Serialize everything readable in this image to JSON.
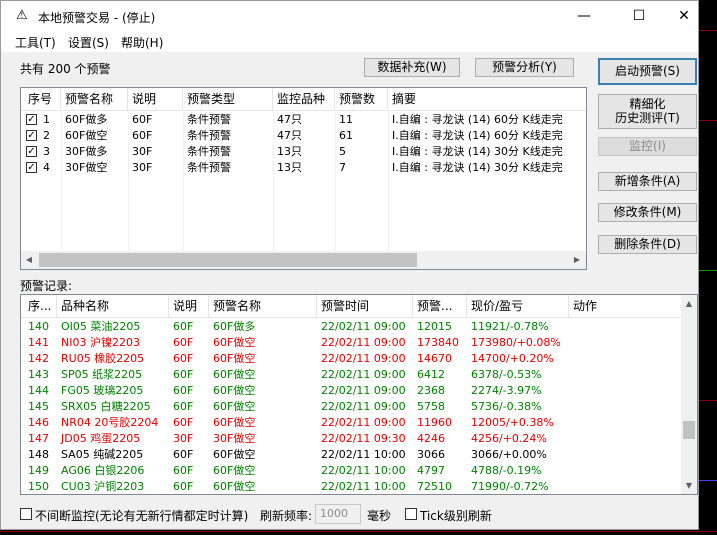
{
  "window": {
    "title": "本地预警交易 - (停止)",
    "app_icon": "warning-triangle-icon",
    "controls": {
      "minimize": "—",
      "maximize": "☐",
      "close": "✕"
    }
  },
  "menu": [
    {
      "label": "工具(T)"
    },
    {
      "label": "设置(S)"
    },
    {
      "label": "帮助(H)"
    }
  ],
  "summary": "共有 200 个预警",
  "toolbar": {
    "data_fill": "数据补充(W)",
    "analysis": "预警分析(Y)"
  },
  "side_buttons": {
    "start": "启动预警(S)",
    "refine_line1": "精细化",
    "refine_line2": "历史测评(T)",
    "monitor": "监控(I)",
    "add": "新增条件(A)",
    "edit": "修改条件(M)",
    "delete": "删除条件(D)"
  },
  "conditions": {
    "headers": [
      "序号",
      "预警名称",
      "说明",
      "预警类型",
      "监控品种",
      "预警数",
      "摘要"
    ],
    "rows": [
      {
        "checked": true,
        "no": "1",
        "name": "60F做多",
        "desc": "60F",
        "type": "条件预警",
        "count_var": "47只",
        "alerts": "11",
        "summary": "I.自编 : 寻龙诀 (14) 60分  K线走完"
      },
      {
        "checked": true,
        "no": "2",
        "name": "60F做空",
        "desc": "60F",
        "type": "条件预警",
        "count_var": "47只",
        "alerts": "61",
        "summary": "I.自编 : 寻龙诀 (14) 60分  K线走完"
      },
      {
        "checked": true,
        "no": "3",
        "name": "30F做多",
        "desc": "30F",
        "type": "条件预警",
        "count_var": "13只",
        "alerts": "5",
        "summary": "I.自编 : 寻龙诀 (14) 30分  K线走完"
      },
      {
        "checked": true,
        "no": "4",
        "name": "30F做空",
        "desc": "30F",
        "type": "条件预警",
        "count_var": "13只",
        "alerts": "7",
        "summary": "I.自编 : 寻龙诀 (14) 30分  K线走完"
      }
    ]
  },
  "records_label": "预警记录:",
  "records": {
    "headers": [
      "序...",
      "品种名称",
      "说明",
      "预警名称",
      "预警时间",
      "预警...",
      "现价/盈亏",
      "动作"
    ],
    "rows": [
      {
        "color": "green",
        "no": "140",
        "item": "OI05 菜油2205",
        "desc": "60F",
        "name": "60F做多",
        "time": "22/02/11 09:00",
        "price": "12015",
        "pnl": "11921/-0.78%"
      },
      {
        "color": "red",
        "no": "141",
        "item": "NI03 沪镍2203",
        "desc": "60F",
        "name": "60F做空",
        "time": "22/02/11 09:00",
        "price": "173840",
        "pnl": "173980/+0.08%"
      },
      {
        "color": "red",
        "no": "142",
        "item": "RU05 橡胶2205",
        "desc": "60F",
        "name": "60F做空",
        "time": "22/02/11 09:00",
        "price": "14670",
        "pnl": "14700/+0.20%"
      },
      {
        "color": "green",
        "no": "143",
        "item": "SP05 纸浆2205",
        "desc": "60F",
        "name": "60F做空",
        "time": "22/02/11 09:00",
        "price": "6412",
        "pnl": "6378/-0.53%"
      },
      {
        "color": "green",
        "no": "144",
        "item": "FG05 玻璃2205",
        "desc": "60F",
        "name": "60F做空",
        "time": "22/02/11 09:00",
        "price": "2368",
        "pnl": "2274/-3.97%"
      },
      {
        "color": "green",
        "no": "145",
        "item": "SRX05 白糖2205",
        "desc": "60F",
        "name": "60F做空",
        "time": "22/02/11 09:00",
        "price": "5758",
        "pnl": "5736/-0.38%"
      },
      {
        "color": "red",
        "no": "146",
        "item": "NR04 20号胶2204",
        "desc": "60F",
        "name": "60F做空",
        "time": "22/02/11 09:00",
        "price": "11960",
        "pnl": "12005/+0.38%"
      },
      {
        "color": "red",
        "no": "147",
        "item": "JD05 鸡蛋2205",
        "desc": "30F",
        "name": "30F做空",
        "time": "22/02/11 09:30",
        "price": "4246",
        "pnl": "4256/+0.24%"
      },
      {
        "color": "black",
        "no": "148",
        "item": "SA05 纯碱2205",
        "desc": "60F",
        "name": "60F做空",
        "time": "22/02/11 10:00",
        "price": "3066",
        "pnl": "3066/+0.00%"
      },
      {
        "color": "green",
        "no": "149",
        "item": "AG06 白银2206",
        "desc": "60F",
        "name": "60F做空",
        "time": "22/02/11 10:00",
        "price": "4797",
        "pnl": "4788/-0.19%"
      },
      {
        "color": "green",
        "no": "150",
        "item": "CU03 沪铜2203",
        "desc": "60F",
        "name": "60F做空",
        "time": "22/02/11 10:00",
        "price": "72510",
        "pnl": "71990/-0.72%"
      }
    ]
  },
  "footer": {
    "continuous_label": "不间断监控(无论有无新行情都定时计算)",
    "refresh_label": "刷新频率:",
    "refresh_value": "1000",
    "ms_label": "毫秒",
    "tick_label": "Tick级别刷新"
  }
}
